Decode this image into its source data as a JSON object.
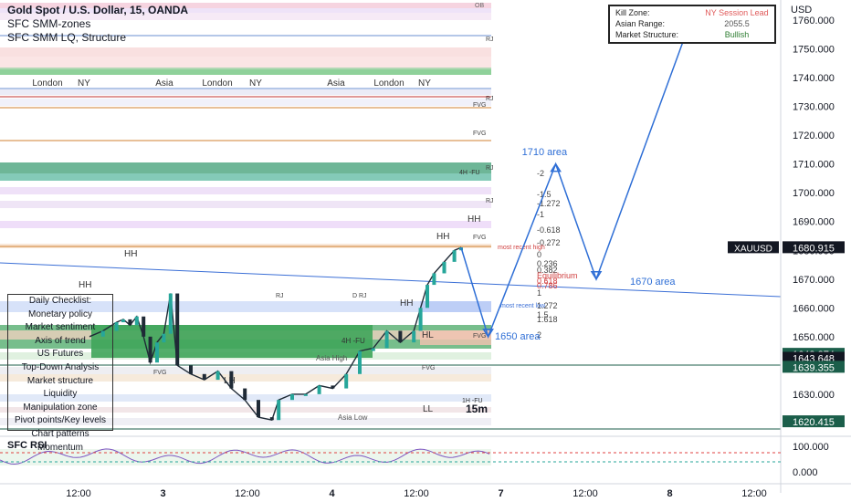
{
  "legend": {
    "symbol": "Gold Spot / U.S. Dollar, 15, OANDA",
    "ind1": "SFC SMM-zones",
    "ind2": "SFC SMM LQ, Structure"
  },
  "infobox": {
    "rows": [
      {
        "key": "Kill Zone:",
        "value": "NY Session Lead",
        "value_color": "#e05a5a"
      },
      {
        "key": "Asian Range:",
        "value": "2055.5",
        "value_color": "#555555"
      },
      {
        "key": "Market Structure:",
        "value": "Bullish",
        "value_color": "#2e7d32"
      }
    ]
  },
  "checklist": {
    "title": "Daily Checklist:",
    "items": [
      "Monetary policy",
      "Market sentiment",
      "Axis of trend",
      "US Futures",
      "Top-Down Analysis",
      "Market structure",
      "Liquidity",
      "Manipulation zone",
      "Pivot points/Key levels",
      "Chart patterns",
      "Momentum"
    ]
  },
  "axis": {
    "currency": "USD",
    "xticks": [
      {
        "label": "12:00",
        "x": 0.0
      },
      {
        "label": "3",
        "x": 0.25
      },
      {
        "label": "12:00",
        "x": 0.5
      },
      {
        "label": "4",
        "x": 0.75
      },
      {
        "label": "12:00",
        "x": 1.0
      },
      {
        "label": "7",
        "x": 1.25
      },
      {
        "label": "12:00",
        "x": 1.5
      },
      {
        "label": "8",
        "x": 1.75
      },
      {
        "label": "12:00",
        "x": 2.0
      }
    ]
  },
  "price_tags": [
    {
      "label": "XAUUSD",
      "value": "1680.915",
      "bg": "#131722",
      "price": 1680.915
    },
    {
      "label": "",
      "value": "1643.874",
      "bg": "#1b5e4a",
      "price": 1643.874
    },
    {
      "label": "",
      "value": "1643.648",
      "bg": "#131722",
      "price": 1642.5
    },
    {
      "label": "",
      "value": "1639.355",
      "bg": "#1b5e4a",
      "price": 1639.355
    },
    {
      "label": "",
      "value": "1620.415",
      "bg": "#1b5e4a",
      "price": 1620.415
    }
  ],
  "sessions": [
    "London",
    "NY",
    "Asia",
    "London",
    "NY",
    "Asia",
    "London",
    "NY"
  ],
  "fib_labels": [
    "-2",
    "-1.5",
    "-1.272",
    "-1",
    "-0.618",
    "-0.272",
    "0",
    "0.236",
    "0.382",
    "Equilibrium",
    "0.618",
    "0.786",
    "1",
    "1.272",
    "1.5",
    "1.618",
    "2"
  ],
  "annotations": {
    "a1710": "1710 area",
    "a1670": "1670 area",
    "a1650": "1650 area",
    "hh": "HH",
    "hl": "HL",
    "lh": "LH",
    "ll": "LL",
    "tf": "15m",
    "fvg": "FVG",
    "rj": "RJ",
    "drj": "D RJ",
    "ob": "OB",
    "fu4h": "4H -FU",
    "fu1h": "1H -FU",
    "asia_high": "Asia High",
    "asia_low": "Asia Low",
    "most_recent_high": "most recent high",
    "most_recent_low": "most recent low"
  },
  "rsi": {
    "title": "SFC RSI",
    "scale": [
      "100.000",
      "0.000"
    ]
  },
  "chart_data": {
    "type": "line",
    "title": "Gold Spot / U.S. Dollar, 15, OANDA",
    "xlabel": "",
    "ylabel": "USD",
    "ylim": [
      1616,
      1767
    ],
    "yticks": [
      1620,
      1630,
      1640,
      1650,
      1660,
      1670,
      1680,
      1690,
      1700,
      1710,
      1720,
      1730,
      1740,
      1750,
      1760
    ],
    "grid": false,
    "series": [
      {
        "name": "XAUUSD",
        "x": [
          0,
          0.04,
          0.08,
          0.1,
          0.12,
          0.14,
          0.16,
          0.18,
          0.2,
          0.22,
          0.24,
          0.26,
          0.3,
          0.34,
          0.38,
          0.42,
          0.46,
          0.5,
          0.54,
          0.56,
          0.6,
          0.64,
          0.68,
          0.72,
          0.76,
          0.8,
          0.84,
          0.88,
          0.92,
          0.96,
          0.98,
          1.0,
          1.02,
          1.05,
          1.08,
          1.1
        ],
        "values": [
          1650,
          1652,
          1655,
          1656,
          1654,
          1657,
          1650,
          1641,
          1648,
          1651,
          1665,
          1640,
          1637,
          1635,
          1638,
          1632,
          1628,
          1622,
          1621,
          1628,
          1630,
          1630,
          1633,
          1632,
          1637,
          1645,
          1646,
          1652,
          1648,
          1652,
          1660,
          1668,
          1672,
          1676,
          1680,
          1681
        ]
      },
      {
        "name": "projection",
        "x": [
          1.1,
          1.18,
          1.38,
          1.5,
          1.78
        ],
        "values": [
          1681,
          1650,
          1710,
          1670,
          1760
        ]
      }
    ]
  }
}
